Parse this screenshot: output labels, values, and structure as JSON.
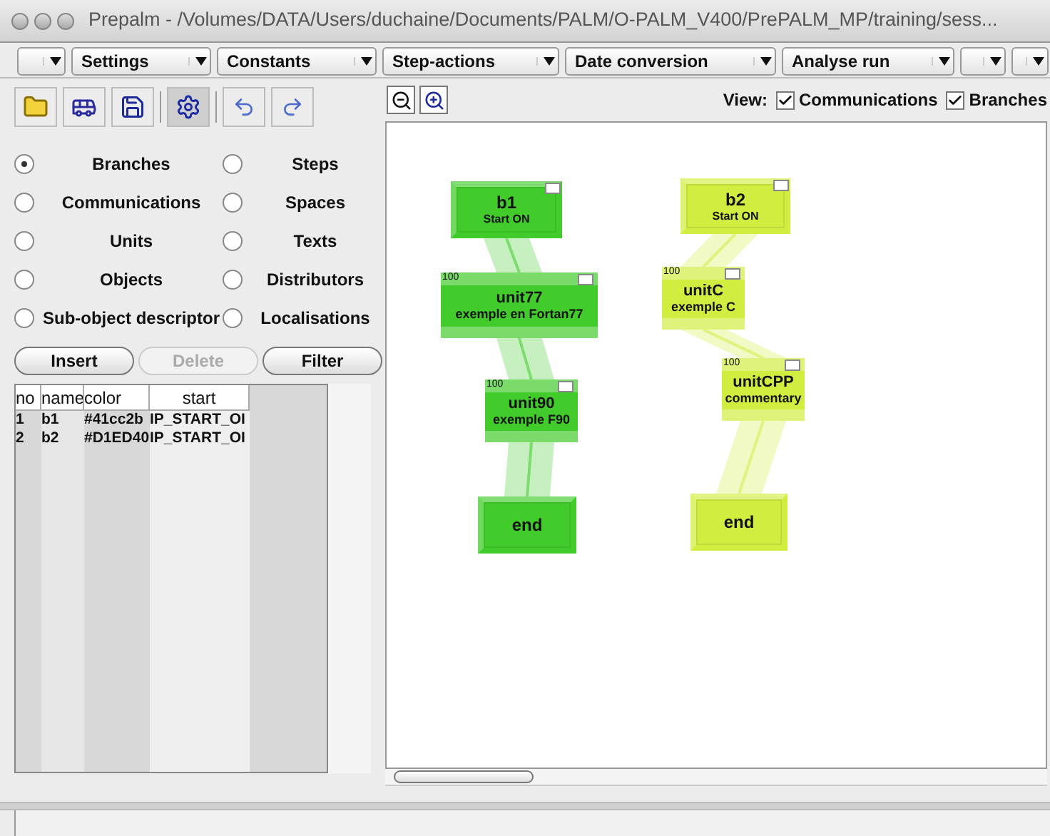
{
  "window": {
    "title": "Prepalm - /Volumes/DATA/Users/duchaine/Documents/PALM/O-PALM_V400/PrePALM_MP/training/sess..."
  },
  "menus": [
    {
      "kind": "blank"
    },
    {
      "kind": "labeled",
      "label": "Settings"
    },
    {
      "kind": "labeled",
      "label": "Constants"
    },
    {
      "kind": "labeled",
      "label": "Step-actions"
    },
    {
      "kind": "labeled",
      "label": "Date conversion"
    },
    {
      "kind": "labeled",
      "label": "Analyse run"
    },
    {
      "kind": "blank"
    },
    {
      "kind": "blank"
    }
  ],
  "view": {
    "label": "View:",
    "options": [
      {
        "label": "Communications",
        "checked": true
      },
      {
        "label": "Branches",
        "checked": true
      }
    ]
  },
  "object_types": [
    {
      "label": "Branches",
      "selected": true
    },
    {
      "label": "Steps",
      "selected": false
    },
    {
      "label": "Communications",
      "selected": false
    },
    {
      "label": "Spaces",
      "selected": false
    },
    {
      "label": "Units",
      "selected": false
    },
    {
      "label": "Texts",
      "selected": false
    },
    {
      "label": "Objects",
      "selected": false
    },
    {
      "label": "Distributors",
      "selected": false
    },
    {
      "label": "Sub-object descriptor",
      "selected": false
    },
    {
      "label": "Localisations",
      "selected": false
    }
  ],
  "buttons": [
    {
      "label": "Insert",
      "disabled": false
    },
    {
      "label": "Delete",
      "disabled": true
    },
    {
      "label": "Filter",
      "disabled": false
    }
  ],
  "table": {
    "columns": [
      "no",
      "name",
      "color",
      "start"
    ],
    "rows": [
      [
        "1",
        "b1",
        "#41cc2b",
        "IP_START_OI"
      ],
      [
        "2",
        "b2",
        "#D1ED40",
        "IP_START_OI"
      ]
    ]
  },
  "diagram": {
    "branches": [
      {
        "color": "#41cc2b",
        "nodes": [
          {
            "kind": "start",
            "title": "b1",
            "subtitle": "Start ON",
            "checked": false
          },
          {
            "kind": "unit",
            "badge": "100",
            "title": "unit77",
            "subtitle": "exemple en Fortan77",
            "checked": false
          },
          {
            "kind": "unit",
            "badge": "100",
            "title": "unit90",
            "subtitle": "exemple F90",
            "checked": false
          },
          {
            "kind": "end",
            "title": "end"
          }
        ]
      },
      {
        "color": "#d1ed40",
        "nodes": [
          {
            "kind": "start",
            "title": "b2",
            "subtitle": "Start ON",
            "checked": false
          },
          {
            "kind": "unit",
            "badge": "100",
            "title": "unitC",
            "subtitle": "exemple C",
            "checked": false
          },
          {
            "kind": "unit",
            "badge": "100",
            "title": "unitCPP",
            "subtitle": "commentary",
            "checked": false
          },
          {
            "kind": "end",
            "title": "end"
          }
        ]
      }
    ]
  }
}
